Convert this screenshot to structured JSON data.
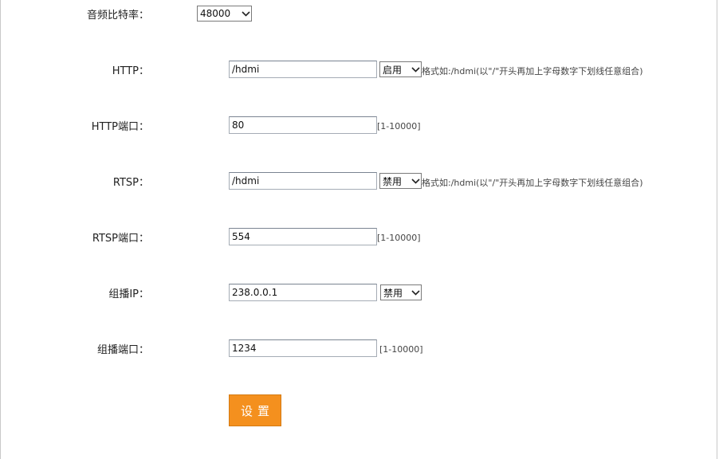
{
  "audio_sample_rate": {
    "label": "音频比特率：",
    "value": "48000"
  },
  "http": {
    "label": "HTTP：",
    "value": "/hdmi",
    "select_value": "启用",
    "hint": "格式如:/hdmi(以\"/\"开头再加上字母数字下划线任意组合)"
  },
  "http_port": {
    "label": "HTTP端口：",
    "value": "80",
    "range": "[1-10000]"
  },
  "rtsp": {
    "label": "RTSP：",
    "value": "/hdmi",
    "select_value": "禁用",
    "hint": "格式如:/hdmi(以\"/\"开头再加上字母数字下划线任意组合)"
  },
  "rtsp_port": {
    "label": "RTSP端口：",
    "value": "554",
    "range": "[1-10000]"
  },
  "multicast_ip": {
    "label": "组播IP：",
    "value": "238.0.0.1",
    "select_value": "禁用"
  },
  "multicast_port": {
    "label": "组播端口：",
    "value": "1234",
    "range": "[1-10000]"
  },
  "submit": {
    "label": "设置"
  },
  "icons": {
    "dropdown": "chevron-down-icon"
  }
}
